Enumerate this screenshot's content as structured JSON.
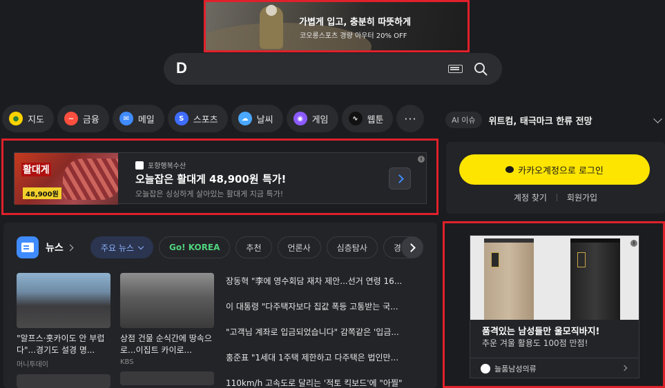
{
  "top_banner": {
    "headline": "가볍게 입고, 충분히 따뜻하게",
    "subline": "코오롱스포츠 경량 아우터 20% OFF"
  },
  "search": {
    "logo": "D",
    "placeholder": ""
  },
  "categories": [
    {
      "label": "지도",
      "icon": "map-pin-icon",
      "color": "#ffd300"
    },
    {
      "label": "금융",
      "icon": "finance-chart-icon",
      "color": "#ff4f3e"
    },
    {
      "label": "메일",
      "icon": "mail-icon",
      "color": "#3f8bff"
    },
    {
      "label": "스포츠",
      "icon": "sports-icon",
      "color": "#3f6dff"
    },
    {
      "label": "날씨",
      "icon": "weather-icon",
      "color": "#4aa8ff"
    },
    {
      "label": "게임",
      "icon": "game-icon",
      "color": "#8b5bff"
    },
    {
      "label": "웹툰",
      "icon": "webtoon-icon",
      "color": "#111111"
    }
  ],
  "more_label": "···",
  "ai_issue": {
    "badge": "AI 이슈",
    "text": "위트컴, 태극마크 한류 전망"
  },
  "ad_top": {
    "brand": "포항행복수산",
    "title": "오늘잡은 활대게 48,900원 특가!",
    "subtitle": "오늘잡은 싱싱하게 살아있는 활대게 지금 특가!",
    "image_text": "활대게",
    "image_price": "48,900원"
  },
  "login": {
    "button": "카카오계정으로 로그인",
    "find_account": "계정 찾기",
    "signup": "회원가입"
  },
  "news": {
    "label": "뉴스",
    "tabs": [
      "주요 뉴스",
      "Go! KOREA",
      "추천",
      "언론사",
      "심층탐사",
      "경제"
    ],
    "cards": [
      {
        "caption": "\"알프스·홋카이도 안 부럽다\"...경기도 설경 명...",
        "source": "머니투데이"
      },
      {
        "caption": "상점 건물 순식간에 땅속으로...이집트 카이로...",
        "source": "KBS"
      }
    ],
    "headlines": [
      "장동혁 \"李에 영수회담 재차 제안...선거 연령 16...",
      "이 대통령 \"다주택자보다 집값 폭등 고통받는 국...",
      "\"고객님 계좌로 입금되었습니다\" 감쪽같은 '입금...",
      "홍준표 \"1세대 1주택 제한하고 다주택은 법인만...",
      "110km/h 고속도로 달리는 '적토 킥보드'에 \"아찔\""
    ]
  },
  "ad_side": {
    "title": "품격있는 남성들만 울모직바지!",
    "subtitle": "추운 겨울 활용도 100점 만점!",
    "brand": "늘품남성의류"
  },
  "colors": {
    "background": "#1b1c1f",
    "panel": "#232428",
    "kakao_yellow": "#fee500",
    "ad_highlight": "#e0212b",
    "accent_blue": "#3f8bff"
  }
}
